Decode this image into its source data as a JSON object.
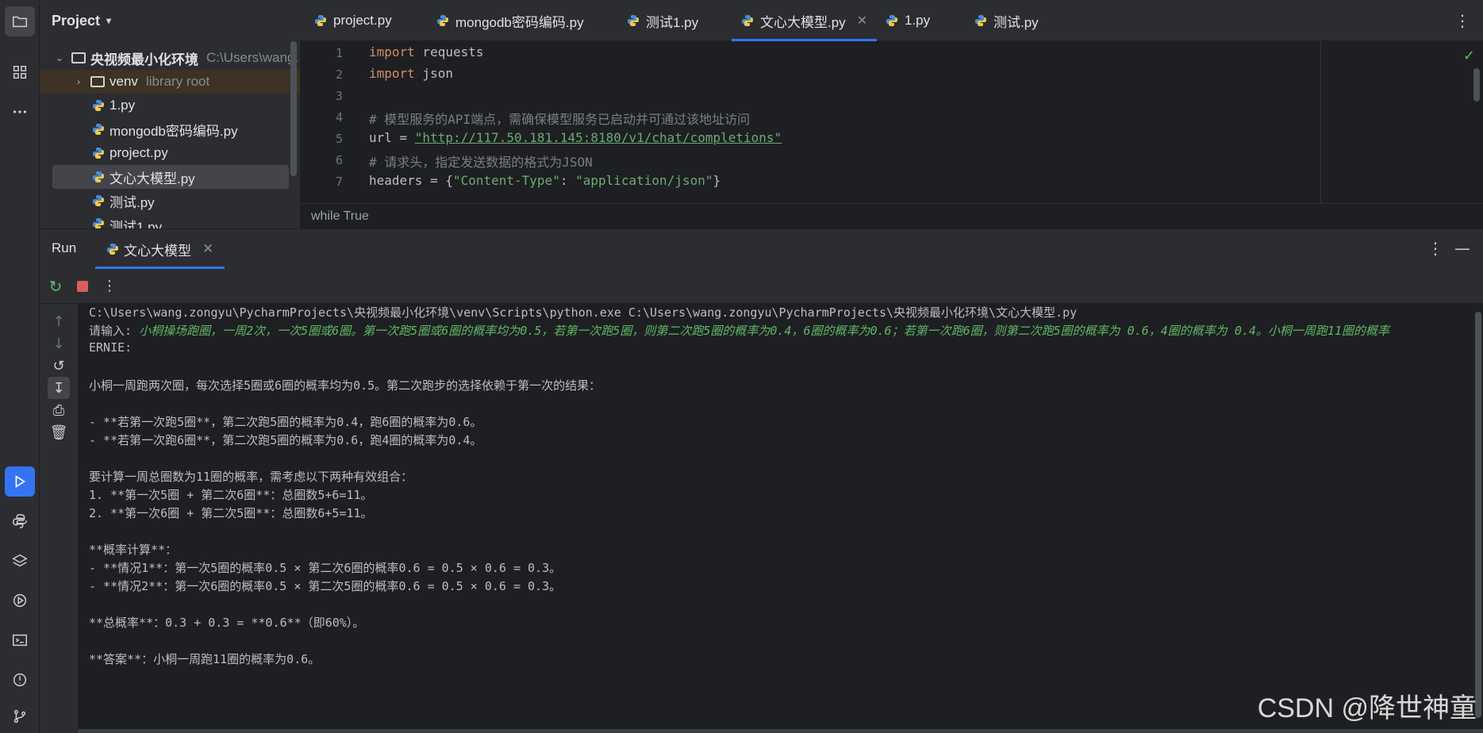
{
  "sidebar": {
    "tools": [
      {
        "icon": "folder-icon"
      },
      {
        "icon": "structure-icon"
      },
      {
        "icon": "more-icon"
      },
      {
        "icon": "run-icon"
      },
      {
        "icon": "python-console-icon"
      },
      {
        "icon": "layers-icon"
      },
      {
        "icon": "services-icon"
      },
      {
        "icon": "terminal-icon"
      },
      {
        "icon": "problems-icon"
      },
      {
        "icon": "git-icon"
      }
    ]
  },
  "project": {
    "title": "Project",
    "root_name": "央视频最小化环境",
    "root_path": "C:\\Users\\wang.",
    "venv_name": "venv",
    "venv_note": "library root",
    "files": [
      "1.py",
      "mongodb密码编码.py",
      "project.py",
      "文心大模型.py",
      "测试.py",
      "测试1.py"
    ]
  },
  "editor": {
    "tabs": [
      "project.py",
      "mongodb密码编码.py",
      "测试1.py",
      "文心大模型.py",
      "1.py",
      "测试.py"
    ],
    "active_tab": "文心大模型.py",
    "lines": {
      "l1_kw": "import",
      "l1_rest": " requests",
      "l2_kw": "import",
      "l2_rest": " json",
      "l4": "# 模型服务的API端点，需确保模型服务已启动并可通过该地址访问",
      "l5_pre": "url = ",
      "l5_url": "\"http://117.50.181.145:8180/v1/chat/completions\"",
      "l6": "# 请求头，指定发送数据的格式为JSON",
      "l7_pre": "headers = {",
      "l7_k": "\"Content-Type\"",
      "l7_mid": ": ",
      "l7_v": "\"application/json\"",
      "l7_end": "}"
    },
    "line_numbers": [
      "1",
      "2",
      "3",
      "4",
      "5",
      "6",
      "7"
    ],
    "breadcrumb": "while True"
  },
  "run": {
    "title": "Run",
    "tab_label": "文心大模型",
    "console": {
      "cmd": "C:\\Users\\wang.zongyu\\PycharmProjects\\央视频最小化环境\\venv\\Scripts\\python.exe C:\\Users\\wang.zongyu\\PycharmProjects\\央视频最小化环境\\文心大模型.py",
      "prompt": "请输入: ",
      "user_input": "小桐操场跑圈，一周2次，一次5圈或6圈。第一次跑5圈或6圈的概率均为0.5，若第一次跑5圈，则第二次跑5圈的概率为0.4，6圈的概率为0.6；若第一次跑6圈，则第二次跑5圈的概率为 0.6，4圈的概率为 0.4。小桐一周跑11圈的概率",
      "ernie": "ERNIE:",
      "l1": "小桐一周跑两次圈，每次选择5圈或6圈的概率均为0.5。第二次跑步的选择依赖于第一次的结果：",
      "l2": "- **若第一次跑5圈**，第二次跑5圈的概率为0.4，跑6圈的概率为0.6。",
      "l3": "- **若第一次跑6圈**，第二次跑5圈的概率为0.6，跑4圈的概率为0.4。",
      "l4": "要计算一周总圈数为11圈的概率，需考虑以下两种有效组合：",
      "l5": "1. **第一次5圈 + 第二次6圈**：总圈数5+6=11。",
      "l6": "2. **第一次6圈 + 第二次5圈**：总圈数6+5=11。",
      "l7": "**概率计算**：",
      "l8": "- **情况1**：第一次5圈的概率0.5 × 第二次6圈的概率0.6 = 0.5 × 0.6 = 0.3。",
      "l9": "- **情况2**：第一次6圈的概率0.5 × 第二次5圈的概率0.6 = 0.5 × 0.6 = 0.3。",
      "l10": "**总概率**：0.3 + 0.3 = **0.6**（即60%）。",
      "l11": "**答案**：小桐一周跑11圈的概率为0.6。"
    }
  },
  "watermark": "CSDN @降世神童",
  "colors": {
    "accent": "#3574f0",
    "keyword": "#cf8e6d",
    "string": "#6aab73",
    "comment": "#7a7e85",
    "input_text": "#5fb865",
    "stop": "#db5c5c"
  }
}
